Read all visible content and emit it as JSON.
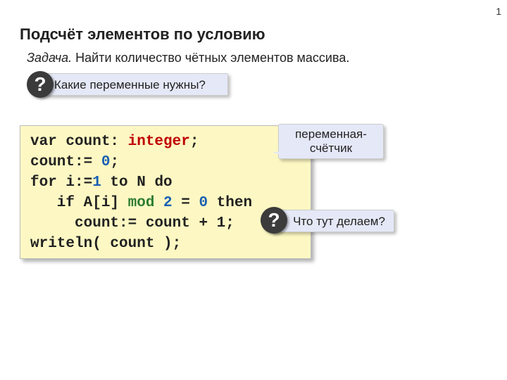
{
  "page_number": "1",
  "title": "Подсчёт элементов по условию",
  "task_label": "Задача.",
  "task_text": " Найти количество чётных элементов массива.",
  "callout1": "Какие переменные нужны?",
  "q_mark": "?",
  "annot1_line1": "переменная-",
  "annot1_line2": "счётчик",
  "annot2": "Что тут делаем?",
  "code": {
    "l1a": "var count: ",
    "l1b": "integer",
    "l1c": ";",
    "l2a": "count:= ",
    "l2b": "0",
    "l2c": ";",
    "l3a": "for i:=",
    "l3b": "1",
    "l3c": " to N do",
    "l4a": "   if A[i] ",
    "l4b": "mod",
    "l4c": " ",
    "l4d": "2",
    "l4e": " = ",
    "l4f": "0",
    "l4g": " then",
    "l5": "     count:= count + 1;",
    "l6": "writeln( count );"
  }
}
